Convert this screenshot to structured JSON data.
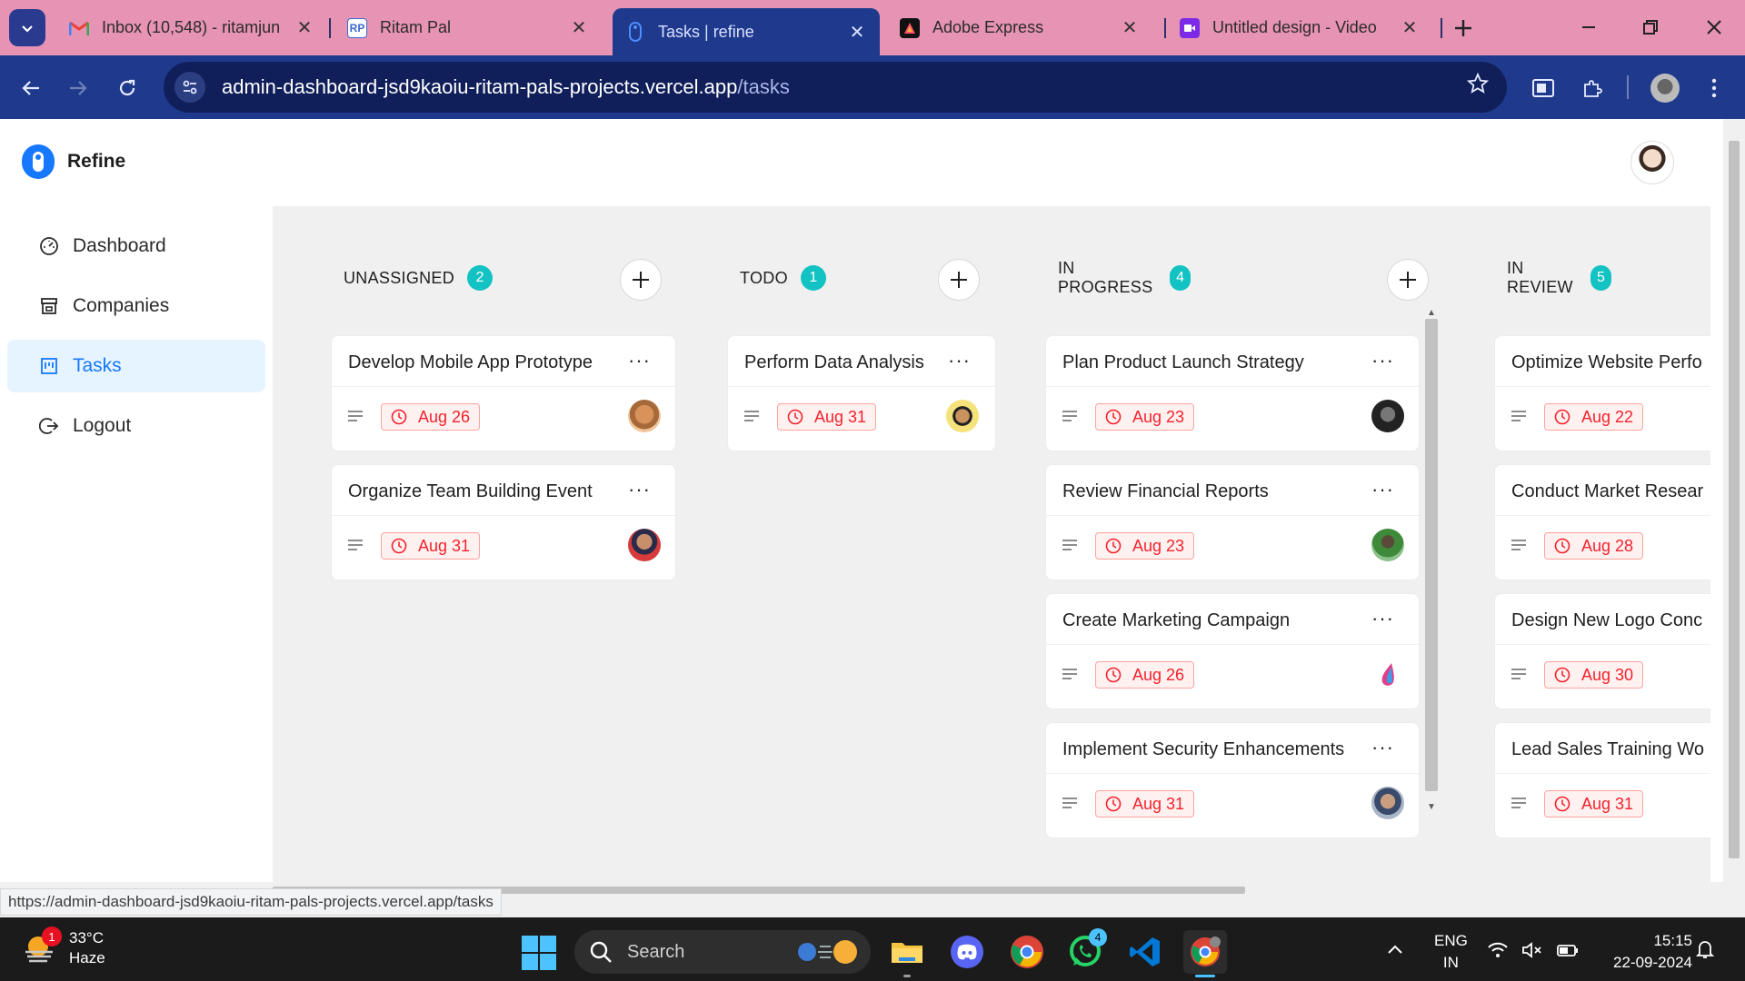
{
  "browser": {
    "tabs": [
      {
        "title": "Inbox (10,548) - ritamjun",
        "favicon": "gmail-icon"
      },
      {
        "title": "Ritam Pal",
        "favicon": "portfolio-icon"
      },
      {
        "title": "Tasks | refine",
        "favicon": "refine-icon",
        "active": true
      },
      {
        "title": "Adobe Express",
        "favicon": "adobe-express-icon"
      },
      {
        "title": "Untitled design - Video",
        "favicon": "canva-video-icon"
      }
    ],
    "close_glyph": "✕",
    "url_host": "admin-dashboard-jsd9kaoiu-ritam-pals-projects.vercel.app",
    "url_path": "/tasks",
    "status_url": "https://admin-dashboard-jsd9kaoiu-ritam-pals-projects.vercel.app/tasks"
  },
  "app": {
    "brand": "Refine",
    "menu": [
      {
        "label": "Dashboard",
        "icon": "dashboard-icon"
      },
      {
        "label": "Companies",
        "icon": "shop-icon"
      },
      {
        "label": "Tasks",
        "icon": "project-icon",
        "selected": true
      },
      {
        "label": "Logout",
        "icon": "logout-icon"
      }
    ],
    "collapse_glyph": "<"
  },
  "board": {
    "more_glyph": "···",
    "columns": [
      {
        "title": "UNASSIGNED",
        "count": "2",
        "cards": [
          {
            "title": "Develop Mobile App Prototype",
            "due": "Aug 26",
            "avatar": "avatar-orange"
          },
          {
            "title": "Organize Team Building Event",
            "due": "Aug 31",
            "avatar": "avatar-red"
          }
        ]
      },
      {
        "title": "TODO",
        "count": "1",
        "cards": [
          {
            "title": "Perform Data Analysis",
            "due": "Aug 31",
            "avatar": "avatar-yellow"
          }
        ]
      },
      {
        "title": "IN PROGRESS",
        "count": "4",
        "cards": [
          {
            "title": "Plan Product Launch Strategy",
            "due": "Aug 23",
            "avatar": "avatar-dark"
          },
          {
            "title": "Review Financial Reports",
            "due": "Aug 23",
            "avatar": "avatar-green"
          },
          {
            "title": "Create Marketing Campaign",
            "due": "Aug 26",
            "avatar": "avatar-drop"
          },
          {
            "title": "Implement Security Enhancements",
            "due": "Aug 31",
            "avatar": "avatar-blue"
          }
        ]
      },
      {
        "title": "IN REVIEW",
        "count": "5",
        "cards": [
          {
            "title": "Optimize Website Perfo",
            "due": "Aug 22"
          },
          {
            "title": "Conduct Market Resear",
            "due": "Aug 28"
          },
          {
            "title": "Design New Logo Conc",
            "due": "Aug 30"
          },
          {
            "title": "Lead Sales Training Wo",
            "due": "Aug 31"
          }
        ]
      }
    ]
  },
  "taskbar": {
    "weather_temp": "33°C",
    "weather_desc": "Haze",
    "weather_badge": "1",
    "search_label": "Search",
    "whatsapp_badge": "4",
    "lang_top": "ENG",
    "lang_bottom": "IN",
    "time": "15:15",
    "date": "22-09-2024"
  }
}
